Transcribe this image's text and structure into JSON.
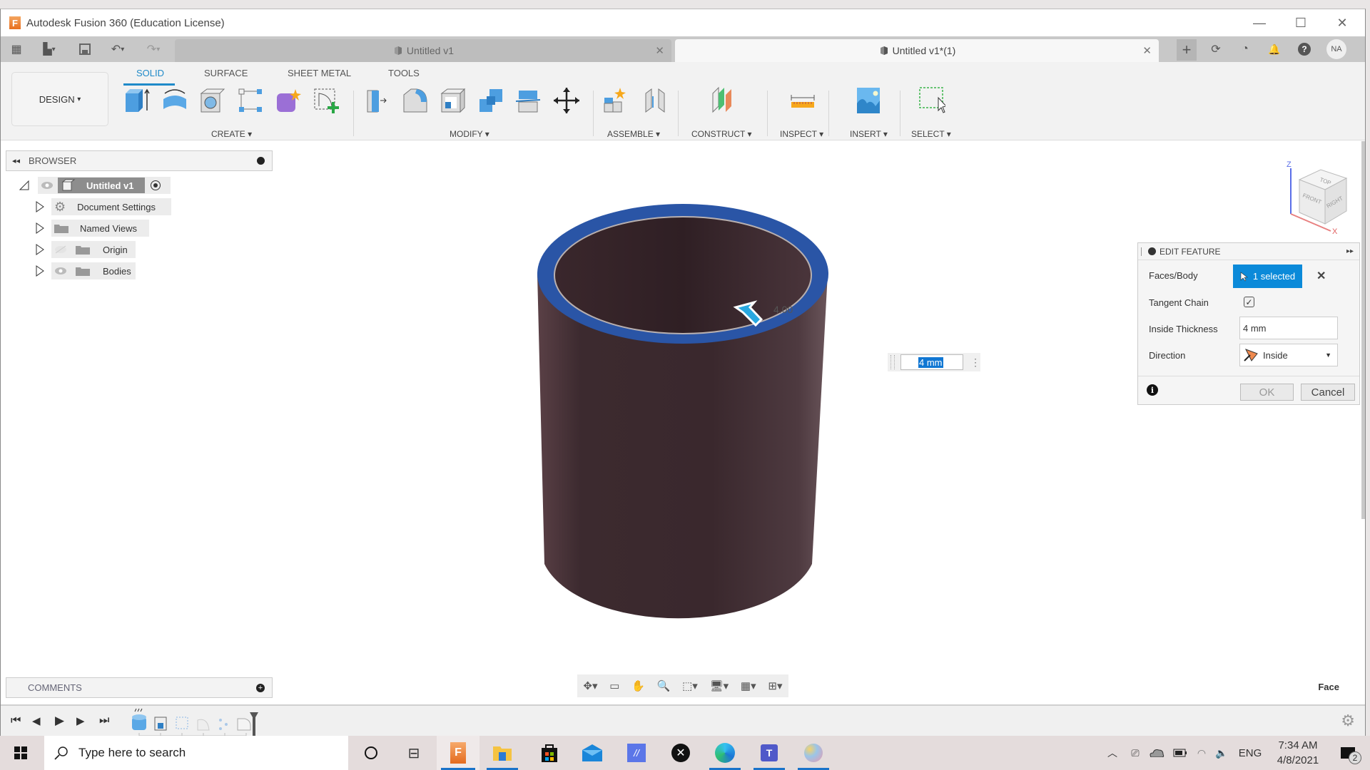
{
  "window": {
    "title": "Autodesk Fusion 360 (Education License)",
    "logo_letter": "F",
    "controls": {
      "minimize": "—",
      "maximize": "☐",
      "close": "✕"
    }
  },
  "quick_access": {
    "grid_icon": "▦",
    "file_icon": "▙",
    "save_icon": "💾",
    "undo_icon": "↶",
    "redo_icon": "↷",
    "dropdown": "▾"
  },
  "doc_tabs": [
    {
      "label": "Untitled v1",
      "active": false,
      "close": "✕"
    },
    {
      "label": "Untitled v1*(1)",
      "active": true,
      "close": "✕"
    }
  ],
  "right_icons": {
    "new_tab": "+",
    "extensions": "⟳",
    "job_status": "◔",
    "notifications": "🔔",
    "help": "?",
    "avatar": "NA"
  },
  "workspace": {
    "label": "DESIGN",
    "caret": "▾"
  },
  "ribbon_tabs": [
    {
      "label": "SOLID",
      "active": true
    },
    {
      "label": "SURFACE",
      "active": false
    },
    {
      "label": "SHEET METAL",
      "active": false
    },
    {
      "label": "TOOLS",
      "active": false
    }
  ],
  "ribbon_groups": [
    {
      "label": "CREATE ▾"
    },
    {
      "label": "MODIFY ▾"
    },
    {
      "label": "ASSEMBLE ▾"
    },
    {
      "label": "CONSTRUCT ▾"
    },
    {
      "label": "INSPECT ▾"
    },
    {
      "label": "INSERT ▾"
    },
    {
      "label": "SELECT ▾"
    }
  ],
  "browser": {
    "title": "BROWSER",
    "collapse_icon": "◂◂",
    "root": {
      "label": "Untitled v1"
    },
    "items": [
      {
        "label": "Document Settings"
      },
      {
        "label": "Named Views"
      },
      {
        "label": "Origin"
      },
      {
        "label": "Bodies"
      }
    ]
  },
  "viewcube": {
    "top": "TOP",
    "front": "FRONT",
    "right": "RIGHT",
    "axis_z": "Z",
    "axis_x": "X"
  },
  "manipulator": {
    "value": "4 mm",
    "hint": "4.00"
  },
  "edit_feature": {
    "title": "EDIT FEATURE",
    "expand_icon": "▸▸",
    "faces_label": "Faces/Body",
    "faces_value": "1 selected",
    "clear_icon": "✕",
    "tangent_label": "Tangent Chain",
    "tangent_checked": true,
    "thickness_label": "Inside Thickness",
    "thickness_value": "4 mm",
    "direction_label": "Direction",
    "direction_value": "Inside",
    "info_icon": "i",
    "ok_label": "OK",
    "cancel_label": "Cancel"
  },
  "comments": {
    "title": "COMMENTS",
    "add_icon": "+"
  },
  "status": {
    "selection_filter": "Face"
  },
  "timeline": {
    "first": "⏮",
    "prev": "◀",
    "play": "▶",
    "next": "▶",
    "last": "⏭",
    "settings_icon": "⚙"
  },
  "taskbar": {
    "search_placeholder": "Type here to search",
    "time": "7:34 AM",
    "date": "4/8/2021",
    "lang": "ENG",
    "notification_count": "2"
  }
}
